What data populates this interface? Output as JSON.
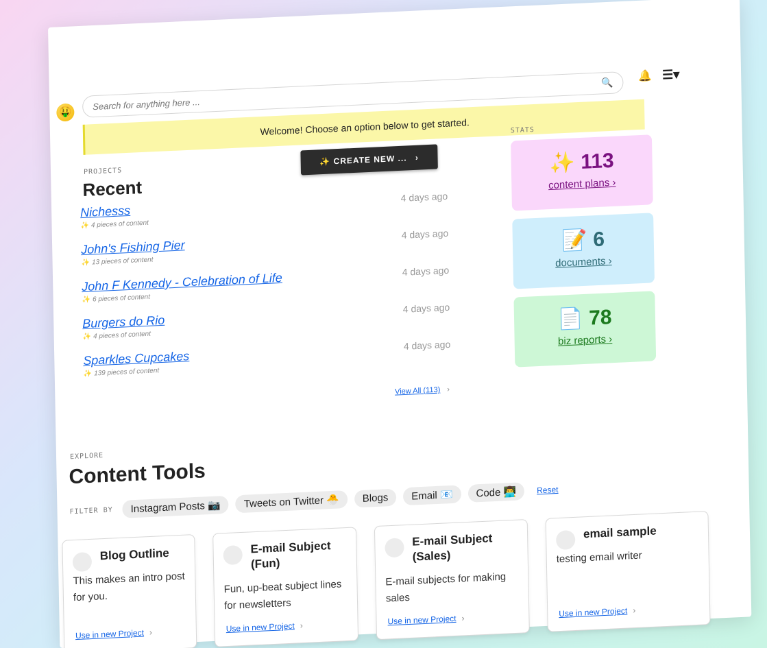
{
  "search": {
    "placeholder": "Search for anything here ..."
  },
  "header": {
    "logo_glyph": "🤑",
    "search_icon": "🔍",
    "bell_icon": "🔔",
    "menu_icon": "☰▾"
  },
  "banner": {
    "text": "Welcome! Choose an option below to get started."
  },
  "projects": {
    "label": "PROJECTS",
    "title": "Recent",
    "create_label": "✨ CREATE NEW ...",
    "create_chevron": "›",
    "items": [
      {
        "name": "Nichesss",
        "meta": "4 pieces of content",
        "ago": "4 days ago"
      },
      {
        "name": "John's Fishing Pier",
        "meta": "13 pieces of content",
        "ago": "4 days ago"
      },
      {
        "name": "John F Kennedy - Celebration of Life",
        "meta": "6 pieces of content",
        "ago": "4 days ago"
      },
      {
        "name": "Burgers do Rio",
        "meta": "4 pieces of content",
        "ago": "4 days ago"
      },
      {
        "name": "Sparkles Cupcakes",
        "meta": "139 pieces of content",
        "ago": "4 days ago"
      }
    ],
    "spark_glyph": "✨",
    "view_all": "View All (113)",
    "view_all_chevron": "›"
  },
  "stats": {
    "label": "STATS",
    "items": [
      {
        "icon": "✨",
        "value": "113",
        "label": "content plans",
        "chevron": "›",
        "color": "#7a1180"
      },
      {
        "icon": "📝",
        "value": "6",
        "label": "documents",
        "chevron": "›",
        "color": "#2f6b76"
      },
      {
        "icon": "📄",
        "value": "78",
        "label": "biz reports",
        "chevron": "›",
        "color": "#1c7a1e"
      }
    ]
  },
  "explore": {
    "label": "EXPLORE",
    "title": "Content Tools",
    "filter_by": "FILTER BY",
    "chips": [
      "Instagram Posts 📷",
      "Tweets on Twitter 🐣",
      "Blogs",
      "Email 📧",
      "Code 👨‍💻"
    ],
    "reset": "Reset"
  },
  "tools": [
    {
      "name": "Blog Outline",
      "desc": "This makes an intro post for you.",
      "use": "Use in new Project"
    },
    {
      "name": "E-mail Subject (Fun)",
      "desc": "Fun, up-beat subject lines for newsletters",
      "use": "Use in new Project"
    },
    {
      "name": "E-mail Subject (Sales)",
      "desc": "E-mail subjects for making sales",
      "use": "Use in new Project"
    },
    {
      "name": "email sample",
      "desc": "testing email writer",
      "use": "Use in new Project"
    }
  ],
  "tool_chevron": "›"
}
